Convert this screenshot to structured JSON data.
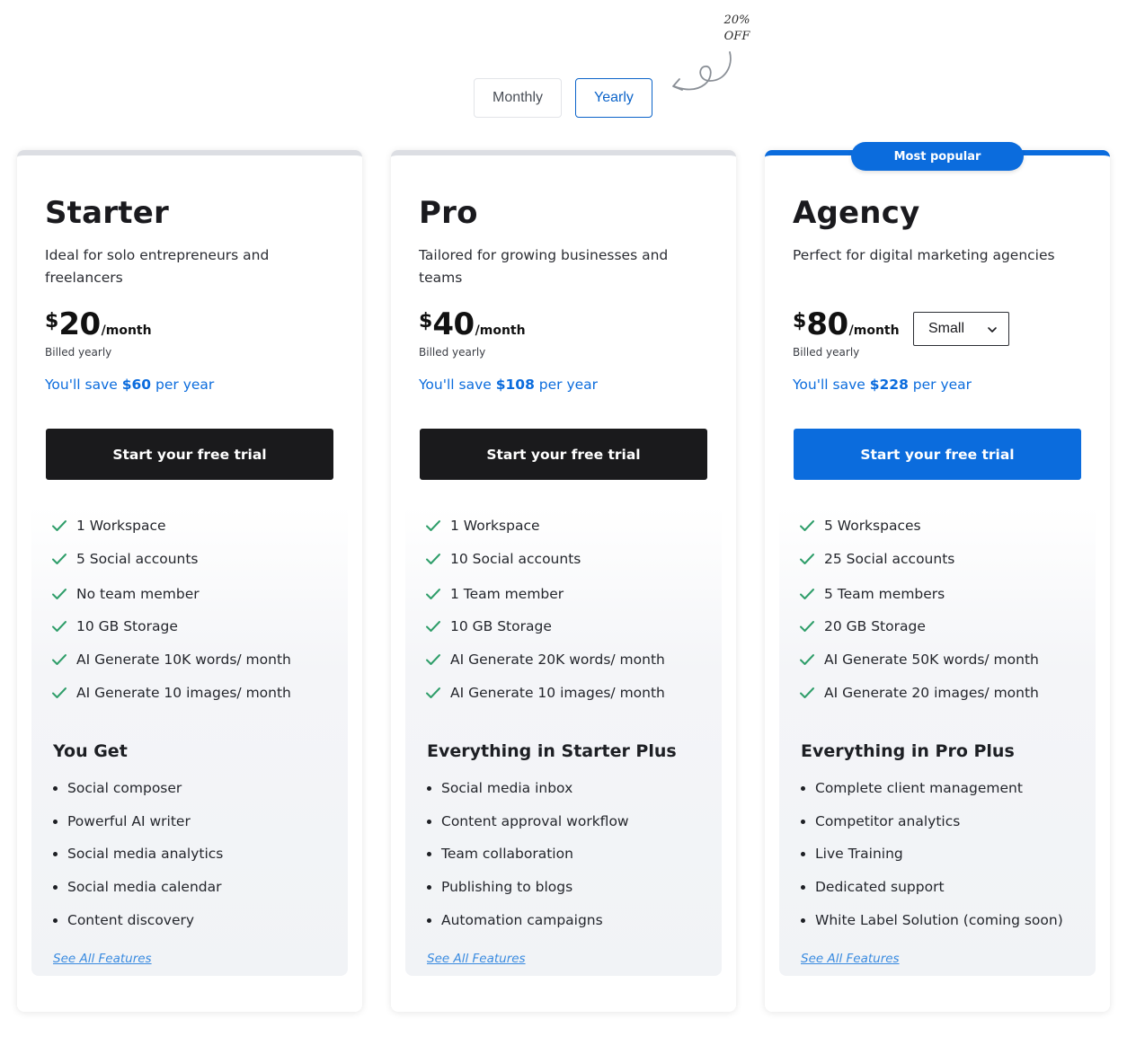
{
  "toggle": {
    "monthly_label": "Monthly",
    "yearly_label": "Yearly",
    "selected": "Yearly",
    "discount_line1": "20%",
    "discount_line2": "OFF"
  },
  "colors": {
    "accent": "#0b6cdd",
    "dark_button": "#1a1a1c",
    "check": "#2f9e6a",
    "savings_text": "#0b6cdd"
  },
  "plans": [
    {
      "name": "Starter",
      "description": "Ideal for solo entrepreneurs and freelancers",
      "currency": "$",
      "price": "20",
      "per": "/month",
      "billed": "Billed yearly",
      "save_prefix": "You'll save ",
      "save_amount": "$60",
      "save_suffix": " per year",
      "cta": "Start your free trial",
      "features": [
        "1 Workspace",
        "5 Social accounts",
        "No team member",
        "10 GB Storage",
        "AI Generate 10K words/ month",
        "AI Generate 10 images/ month"
      ],
      "extras_title": "You Get",
      "extras": [
        "Social composer",
        "Powerful AI writer",
        "Social media analytics",
        "Social media calendar",
        "Content discovery"
      ],
      "see_all": "See All Features"
    },
    {
      "name": "Pro",
      "description": "Tailored for growing businesses and teams",
      "currency": "$",
      "price": "40",
      "per": "/month",
      "billed": "Billed yearly",
      "save_prefix": "You'll save ",
      "save_amount": "$108",
      "save_suffix": " per year",
      "cta": "Start your free trial",
      "features": [
        "1 Workspace",
        "10 Social accounts",
        "1 Team member",
        "10 GB Storage",
        "AI Generate 20K words/ month",
        "AI Generate 10 images/ month"
      ],
      "extras_title": "Everything in Starter Plus",
      "extras": [
        "Social media inbox",
        "Content approval workflow",
        "Team collaboration",
        "Publishing to blogs",
        "Automation campaigns"
      ],
      "see_all": "See All Features"
    },
    {
      "name": "Agency",
      "badge": "Most popular",
      "description": "Perfect for digital marketing agencies",
      "currency": "$",
      "price": "80",
      "per": "/month",
      "size_select": "Small",
      "billed": "Billed yearly",
      "save_prefix": "You'll save ",
      "save_amount": "$228",
      "save_suffix": " per year",
      "cta": "Start your free trial",
      "features": [
        "5 Workspaces",
        "25 Social accounts",
        "5 Team members",
        "20 GB Storage",
        "AI Generate 50K words/ month",
        "AI Generate 20 images/ month"
      ],
      "extras_title": "Everything in Pro Plus",
      "extras": [
        "Complete client management",
        "Competitor analytics",
        "Live Training",
        "Dedicated support",
        "White Label Solution (coming soon)"
      ],
      "see_all": "See All Features"
    }
  ]
}
